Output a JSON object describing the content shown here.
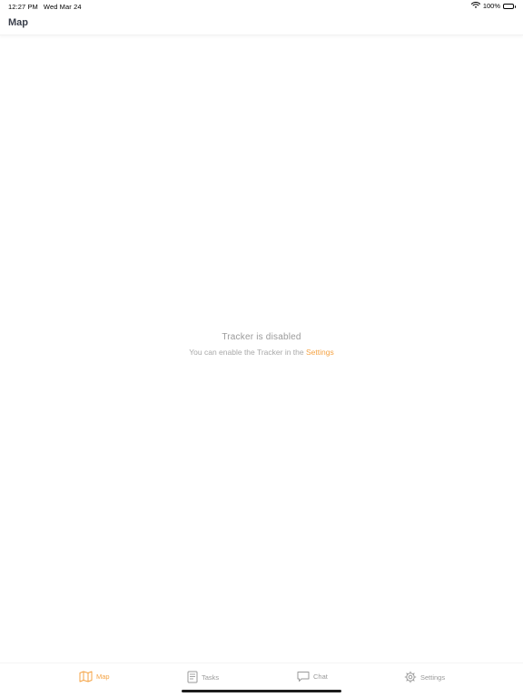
{
  "status_bar": {
    "time": "12:27 PM",
    "date": "Wed Mar 24",
    "battery": "100%"
  },
  "nav": {
    "title": "Map"
  },
  "empty_state": {
    "title": "Tracker is disabled",
    "message": "You can enable the Tracker in the ",
    "link_label": "Settings"
  },
  "tabs": [
    {
      "label": "Map",
      "icon": "map-icon",
      "active": true
    },
    {
      "label": "Tasks",
      "icon": "document-icon",
      "active": false
    },
    {
      "label": "Chat",
      "icon": "chat-bubble-icon",
      "active": false
    },
    {
      "label": "Settings",
      "icon": "gear-icon",
      "active": false
    }
  ],
  "colors": {
    "accent": "#f5a344",
    "inactive": "#9a9a9a",
    "title": "#3a3f4b"
  }
}
